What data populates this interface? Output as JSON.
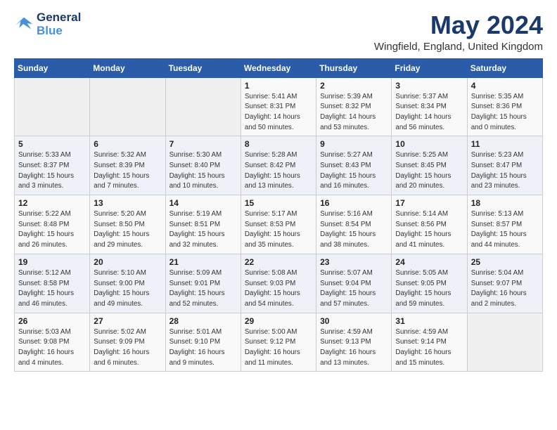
{
  "header": {
    "logo_line1": "General",
    "logo_line2": "Blue",
    "month": "May 2024",
    "location": "Wingfield, England, United Kingdom"
  },
  "weekdays": [
    "Sunday",
    "Monday",
    "Tuesday",
    "Wednesday",
    "Thursday",
    "Friday",
    "Saturday"
  ],
  "weeks": [
    [
      {
        "day": "",
        "sunrise": "",
        "sunset": "",
        "daylight": ""
      },
      {
        "day": "",
        "sunrise": "",
        "sunset": "",
        "daylight": ""
      },
      {
        "day": "",
        "sunrise": "",
        "sunset": "",
        "daylight": ""
      },
      {
        "day": "1",
        "sunrise": "Sunrise: 5:41 AM",
        "sunset": "Sunset: 8:31 PM",
        "daylight": "Daylight: 14 hours and 50 minutes."
      },
      {
        "day": "2",
        "sunrise": "Sunrise: 5:39 AM",
        "sunset": "Sunset: 8:32 PM",
        "daylight": "Daylight: 14 hours and 53 minutes."
      },
      {
        "day": "3",
        "sunrise": "Sunrise: 5:37 AM",
        "sunset": "Sunset: 8:34 PM",
        "daylight": "Daylight: 14 hours and 56 minutes."
      },
      {
        "day": "4",
        "sunrise": "Sunrise: 5:35 AM",
        "sunset": "Sunset: 8:36 PM",
        "daylight": "Daylight: 15 hours and 0 minutes."
      }
    ],
    [
      {
        "day": "5",
        "sunrise": "Sunrise: 5:33 AM",
        "sunset": "Sunset: 8:37 PM",
        "daylight": "Daylight: 15 hours and 3 minutes."
      },
      {
        "day": "6",
        "sunrise": "Sunrise: 5:32 AM",
        "sunset": "Sunset: 8:39 PM",
        "daylight": "Daylight: 15 hours and 7 minutes."
      },
      {
        "day": "7",
        "sunrise": "Sunrise: 5:30 AM",
        "sunset": "Sunset: 8:40 PM",
        "daylight": "Daylight: 15 hours and 10 minutes."
      },
      {
        "day": "8",
        "sunrise": "Sunrise: 5:28 AM",
        "sunset": "Sunset: 8:42 PM",
        "daylight": "Daylight: 15 hours and 13 minutes."
      },
      {
        "day": "9",
        "sunrise": "Sunrise: 5:27 AM",
        "sunset": "Sunset: 8:43 PM",
        "daylight": "Daylight: 15 hours and 16 minutes."
      },
      {
        "day": "10",
        "sunrise": "Sunrise: 5:25 AM",
        "sunset": "Sunset: 8:45 PM",
        "daylight": "Daylight: 15 hours and 20 minutes."
      },
      {
        "day": "11",
        "sunrise": "Sunrise: 5:23 AM",
        "sunset": "Sunset: 8:47 PM",
        "daylight": "Daylight: 15 hours and 23 minutes."
      }
    ],
    [
      {
        "day": "12",
        "sunrise": "Sunrise: 5:22 AM",
        "sunset": "Sunset: 8:48 PM",
        "daylight": "Daylight: 15 hours and 26 minutes."
      },
      {
        "day": "13",
        "sunrise": "Sunrise: 5:20 AM",
        "sunset": "Sunset: 8:50 PM",
        "daylight": "Daylight: 15 hours and 29 minutes."
      },
      {
        "day": "14",
        "sunrise": "Sunrise: 5:19 AM",
        "sunset": "Sunset: 8:51 PM",
        "daylight": "Daylight: 15 hours and 32 minutes."
      },
      {
        "day": "15",
        "sunrise": "Sunrise: 5:17 AM",
        "sunset": "Sunset: 8:53 PM",
        "daylight": "Daylight: 15 hours and 35 minutes."
      },
      {
        "day": "16",
        "sunrise": "Sunrise: 5:16 AM",
        "sunset": "Sunset: 8:54 PM",
        "daylight": "Daylight: 15 hours and 38 minutes."
      },
      {
        "day": "17",
        "sunrise": "Sunrise: 5:14 AM",
        "sunset": "Sunset: 8:56 PM",
        "daylight": "Daylight: 15 hours and 41 minutes."
      },
      {
        "day": "18",
        "sunrise": "Sunrise: 5:13 AM",
        "sunset": "Sunset: 8:57 PM",
        "daylight": "Daylight: 15 hours and 44 minutes."
      }
    ],
    [
      {
        "day": "19",
        "sunrise": "Sunrise: 5:12 AM",
        "sunset": "Sunset: 8:58 PM",
        "daylight": "Daylight: 15 hours and 46 minutes."
      },
      {
        "day": "20",
        "sunrise": "Sunrise: 5:10 AM",
        "sunset": "Sunset: 9:00 PM",
        "daylight": "Daylight: 15 hours and 49 minutes."
      },
      {
        "day": "21",
        "sunrise": "Sunrise: 5:09 AM",
        "sunset": "Sunset: 9:01 PM",
        "daylight": "Daylight: 15 hours and 52 minutes."
      },
      {
        "day": "22",
        "sunrise": "Sunrise: 5:08 AM",
        "sunset": "Sunset: 9:03 PM",
        "daylight": "Daylight: 15 hours and 54 minutes."
      },
      {
        "day": "23",
        "sunrise": "Sunrise: 5:07 AM",
        "sunset": "Sunset: 9:04 PM",
        "daylight": "Daylight: 15 hours and 57 minutes."
      },
      {
        "day": "24",
        "sunrise": "Sunrise: 5:05 AM",
        "sunset": "Sunset: 9:05 PM",
        "daylight": "Daylight: 15 hours and 59 minutes."
      },
      {
        "day": "25",
        "sunrise": "Sunrise: 5:04 AM",
        "sunset": "Sunset: 9:07 PM",
        "daylight": "Daylight: 16 hours and 2 minutes."
      }
    ],
    [
      {
        "day": "26",
        "sunrise": "Sunrise: 5:03 AM",
        "sunset": "Sunset: 9:08 PM",
        "daylight": "Daylight: 16 hours and 4 minutes."
      },
      {
        "day": "27",
        "sunrise": "Sunrise: 5:02 AM",
        "sunset": "Sunset: 9:09 PM",
        "daylight": "Daylight: 16 hours and 6 minutes."
      },
      {
        "day": "28",
        "sunrise": "Sunrise: 5:01 AM",
        "sunset": "Sunset: 9:10 PM",
        "daylight": "Daylight: 16 hours and 9 minutes."
      },
      {
        "day": "29",
        "sunrise": "Sunrise: 5:00 AM",
        "sunset": "Sunset: 9:12 PM",
        "daylight": "Daylight: 16 hours and 11 minutes."
      },
      {
        "day": "30",
        "sunrise": "Sunrise: 4:59 AM",
        "sunset": "Sunset: 9:13 PM",
        "daylight": "Daylight: 16 hours and 13 minutes."
      },
      {
        "day": "31",
        "sunrise": "Sunrise: 4:59 AM",
        "sunset": "Sunset: 9:14 PM",
        "daylight": "Daylight: 16 hours and 15 minutes."
      },
      {
        "day": "",
        "sunrise": "",
        "sunset": "",
        "daylight": ""
      }
    ]
  ]
}
